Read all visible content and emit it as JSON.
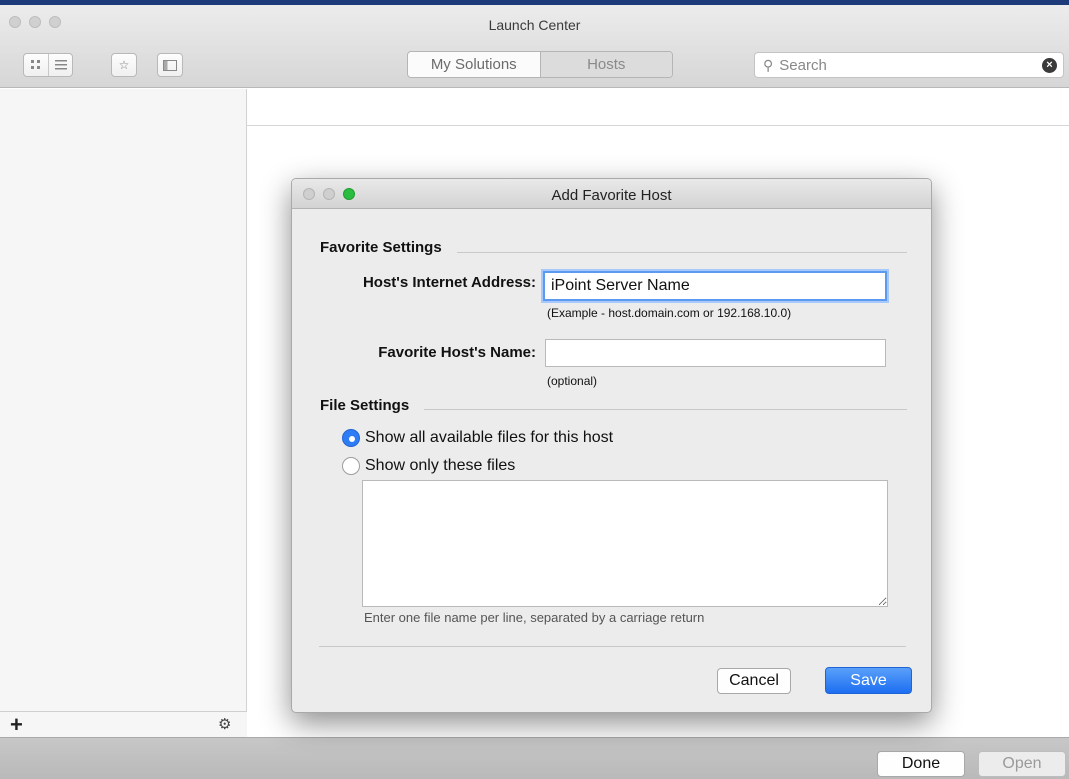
{
  "window": {
    "title": "Launch Center"
  },
  "toolbar": {
    "view_icons": [
      "grid-view-icon",
      "list-view-icon"
    ],
    "favorites_icon": "star-icon",
    "sidebar_icon": "sidebar-toggle-icon",
    "tabs": [
      {
        "label": "My Solutions",
        "selected": false
      },
      {
        "label": "Hosts",
        "selected": true
      }
    ],
    "search": {
      "placeholder": "Search",
      "clear_icon": "clear-icon"
    }
  },
  "sidebar": {
    "add_label": "+",
    "settings_icon": "gear-icon"
  },
  "bottom_bar": {
    "done_label": "Done",
    "open_label": "Open"
  },
  "dialog": {
    "title": "Add Favorite Host",
    "favorite_settings": {
      "heading": "Favorite Settings",
      "address_label": "Host's Internet Address:",
      "address_value": "iPoint Server Name",
      "address_hint": "(Example - host.domain.com or 192.168.10.0)",
      "name_label": "Favorite Host's Name:",
      "name_value": "",
      "name_hint": "(optional)"
    },
    "file_settings": {
      "heading": "File Settings",
      "options": [
        {
          "label": "Show all available files for this host",
          "checked": true
        },
        {
          "label": "Show only these files",
          "checked": false
        }
      ],
      "files_value": "",
      "files_hint": "Enter one file name per line, separated by a carriage return"
    },
    "cancel_label": "Cancel",
    "save_label": "Save"
  },
  "colors": {
    "accent": "#2e7cf6",
    "focus_ring": "#5b9af0",
    "traffic_green": "#2bbd3f"
  }
}
